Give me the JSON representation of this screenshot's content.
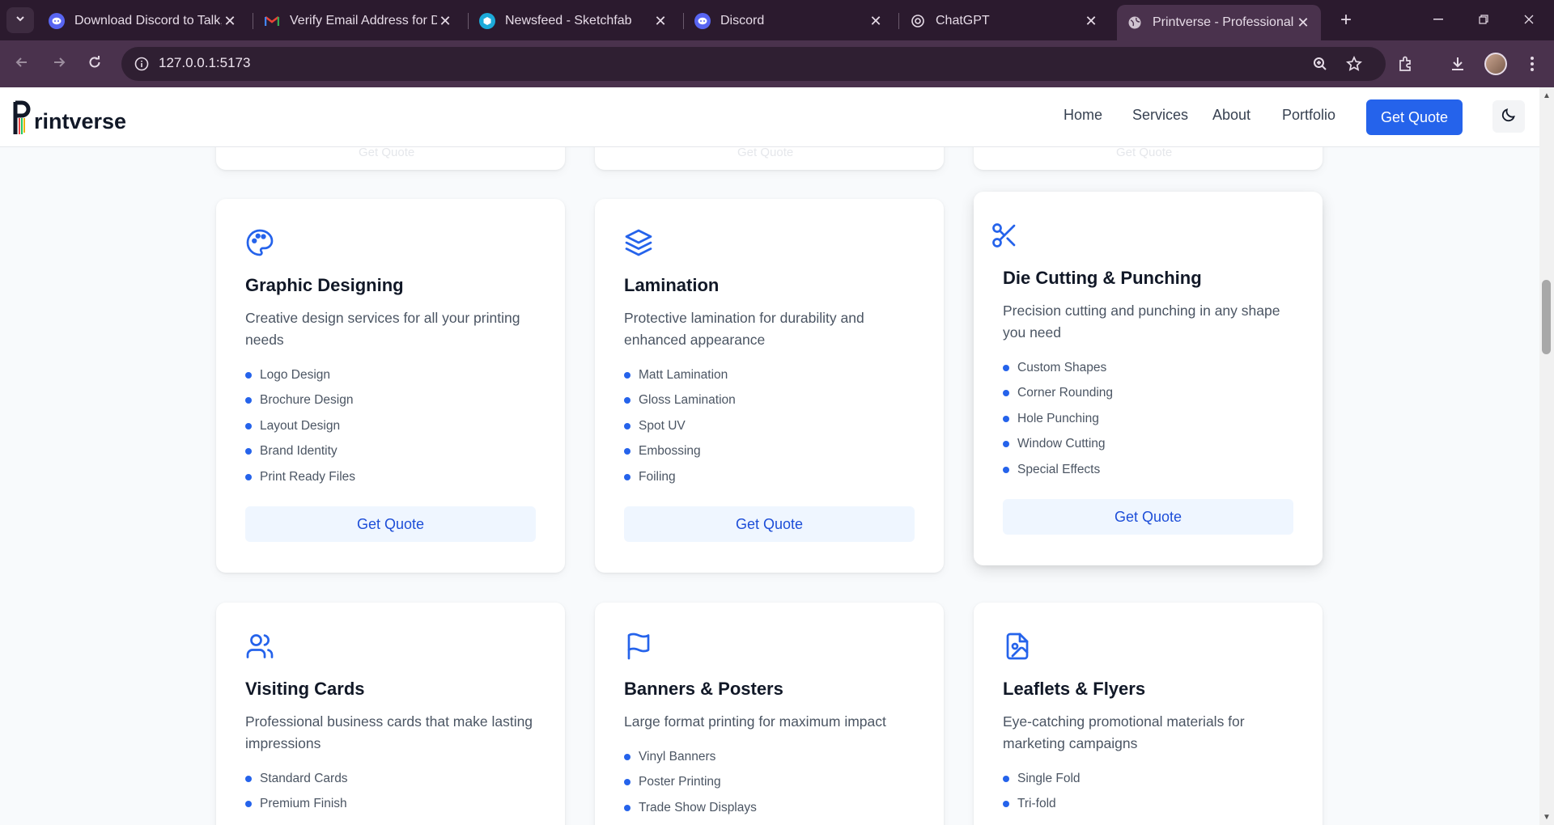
{
  "browser": {
    "tabs": [
      {
        "title": "Download Discord to Talk,",
        "icon": "discord-icon",
        "color": "#5865f2"
      },
      {
        "title": "Verify Email Address for Di",
        "icon": "gmail-icon",
        "color": "#ea4335"
      },
      {
        "title": "Newsfeed - Sketchfab",
        "icon": "sketchfab-icon",
        "color": "#1caad9"
      },
      {
        "title": "Discord",
        "icon": "discord-icon",
        "color": "#5865f2"
      },
      {
        "title": "ChatGPT",
        "icon": "chatgpt-icon",
        "color": "#e6dbe7"
      },
      {
        "title": "Printverse - Professional Pr",
        "icon": "globe-icon",
        "color": "#cfc3d0"
      }
    ],
    "url": "127.0.0.1:5173"
  },
  "header": {
    "logo_text": "rintverse",
    "nav": [
      "Home",
      "Services",
      "About",
      "Portfolio"
    ],
    "cta": "Get Quote"
  },
  "top_cards": [
    {
      "link": "Get Quote"
    },
    {
      "link": "Get Quote"
    },
    {
      "link": "Get Quote"
    }
  ],
  "services": [
    {
      "icon": "palette-icon",
      "title": "Graphic Designing",
      "description": "Creative design services for all your printing needs",
      "features": [
        "Logo Design",
        "Brochure Design",
        "Layout Design",
        "Brand Identity",
        "Print Ready Files"
      ],
      "button": "Get Quote"
    },
    {
      "icon": "layers-icon",
      "title": "Lamination",
      "description": "Protective lamination for durability and enhanced appearance",
      "features": [
        "Matt Lamination",
        "Gloss Lamination",
        "Spot UV",
        "Embossing",
        "Foiling"
      ],
      "button": "Get Quote"
    },
    {
      "icon": "scissors-icon",
      "title": "Die Cutting & Punching",
      "description": "Precision cutting and punching in any shape you need",
      "features": [
        "Custom Shapes",
        "Corner Rounding",
        "Hole Punching",
        "Window Cutting",
        "Special Effects"
      ],
      "button": "Get Quote"
    },
    {
      "icon": "users-icon",
      "title": "Visiting Cards",
      "description": "Professional business cards that make lasting impressions",
      "features": [
        "Standard Cards",
        "Premium Finish"
      ]
    },
    {
      "icon": "flag-icon",
      "title": "Banners & Posters",
      "description": "Large format printing for maximum impact",
      "features": [
        "Vinyl Banners",
        "Poster Printing",
        "Trade Show Displays"
      ]
    },
    {
      "icon": "file-image-icon",
      "title": "Leaflets & Flyers",
      "description": "Eye-catching promotional materials for marketing campaigns",
      "features": [
        "Single Fold",
        "Tri-fold"
      ]
    }
  ],
  "colors": {
    "accent": "#2563eb",
    "accent_soft": "#eff6ff",
    "chrome": "#2b1a2e"
  }
}
